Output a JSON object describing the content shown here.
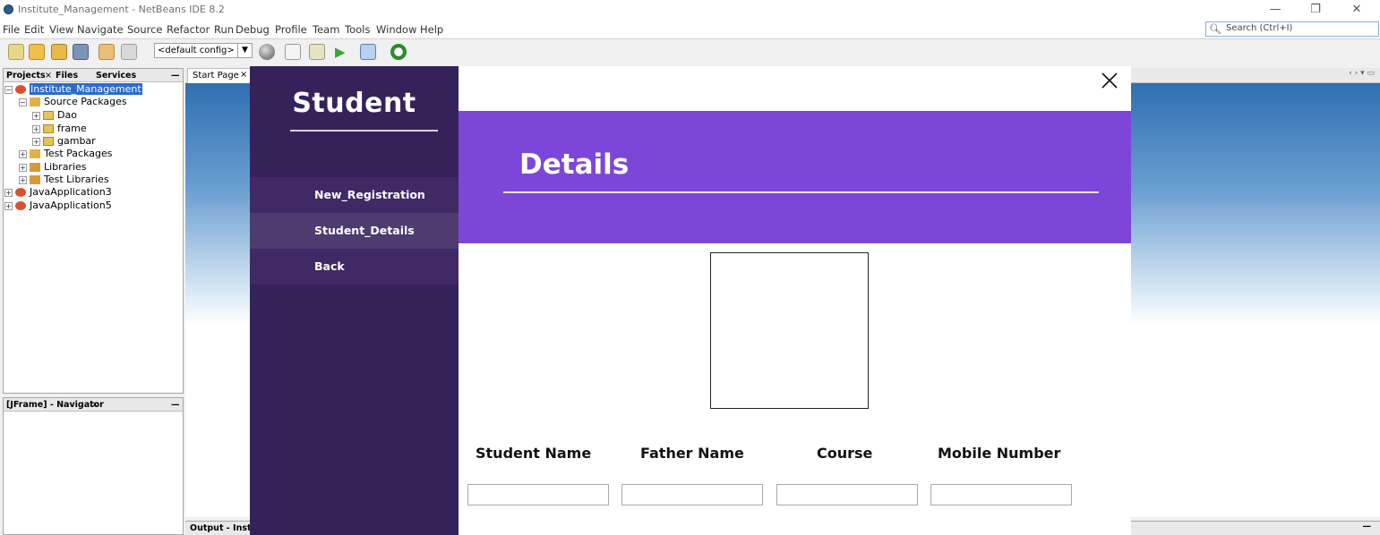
{
  "window": {
    "title": "Institute_Management - NetBeans IDE 8.2",
    "controls": {
      "minimize": "—",
      "restore": "❐",
      "close": "✕"
    }
  },
  "menu": [
    "File",
    "Edit",
    "View",
    "Navigate",
    "Source",
    "Refactor",
    "Run",
    "Debug",
    "Profile",
    "Team",
    "Tools",
    "Window",
    "Help"
  ],
  "search": {
    "placeholder": "Search (Ctrl+I)"
  },
  "toolbar": {
    "config": "<default config>"
  },
  "projects_panel": {
    "tabs": [
      "Projects",
      "Files",
      "Services"
    ],
    "tree": [
      "Institute_Management",
      "Source Packages",
      "Dao",
      "frame",
      "gambar",
      "Test Packages",
      "Libraries",
      "Test Libraries",
      "JavaApplication3",
      "JavaApplication5"
    ]
  },
  "navigator": {
    "tab": "[JFrame] - Navigator"
  },
  "editor": {
    "tab": "Start Page"
  },
  "output": {
    "tab": "Output - Institut"
  },
  "student_form": {
    "sidebar_title": "Student",
    "menu": [
      "New_Registration",
      "Student_Details",
      "Back"
    ],
    "selected_menu": "Student_Details",
    "header_title": "Details",
    "fields": [
      "Student Name",
      "Father Name",
      "Course",
      "Mobile Number"
    ],
    "colors": {
      "sidebar": "#36225b",
      "sidebar_selected": "#4e3b70",
      "header": "#7c47d8"
    }
  }
}
